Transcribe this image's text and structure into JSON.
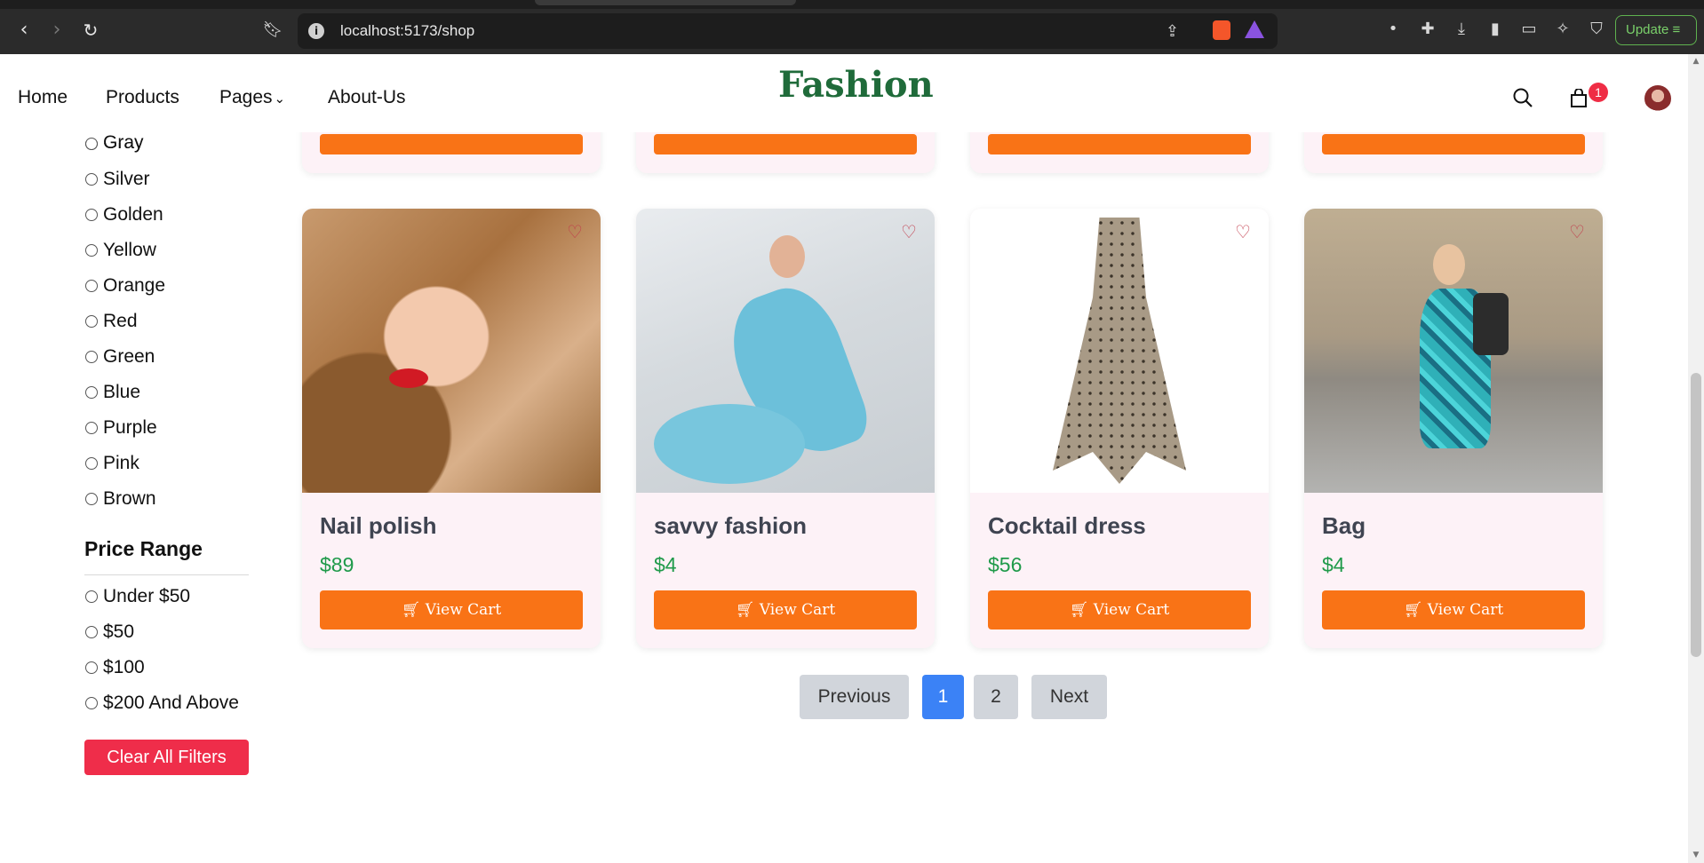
{
  "browser": {
    "url": "localhost:5173/shop",
    "update_label": "Update"
  },
  "nav": {
    "brand": "Fashion",
    "links": [
      "Home",
      "Products",
      "Pages",
      "About-Us"
    ],
    "cart_count": "1"
  },
  "filters": {
    "colors": [
      "Gray",
      "Silver",
      "Golden",
      "Yellow",
      "Orange",
      "Red",
      "Green",
      "Blue",
      "Purple",
      "Pink",
      "Brown"
    ],
    "price_title": "Price Range",
    "price_ranges": [
      "Under $50",
      "$50",
      "$100",
      "$200 And Above"
    ],
    "clear_label": "Clear All Filters"
  },
  "products": [
    {
      "name": "Nail polish",
      "price": "$89",
      "button": "View Cart"
    },
    {
      "name": "savvy fashion",
      "price": "$4",
      "button": "View Cart"
    },
    {
      "name": "Cocktail dress",
      "price": "$56",
      "button": "View Cart"
    },
    {
      "name": "Bag",
      "price": "$4",
      "button": "View Cart"
    }
  ],
  "pagination": {
    "previous": "Previous",
    "pages": [
      "1",
      "2"
    ],
    "current": "1",
    "next": "Next"
  },
  "colors": {
    "accent_orange": "#f97316",
    "price_green": "#1f9a4a",
    "clear_red": "#ef2d4a",
    "active_page": "#3b82f6",
    "brand_green": "#1f6b3a"
  }
}
